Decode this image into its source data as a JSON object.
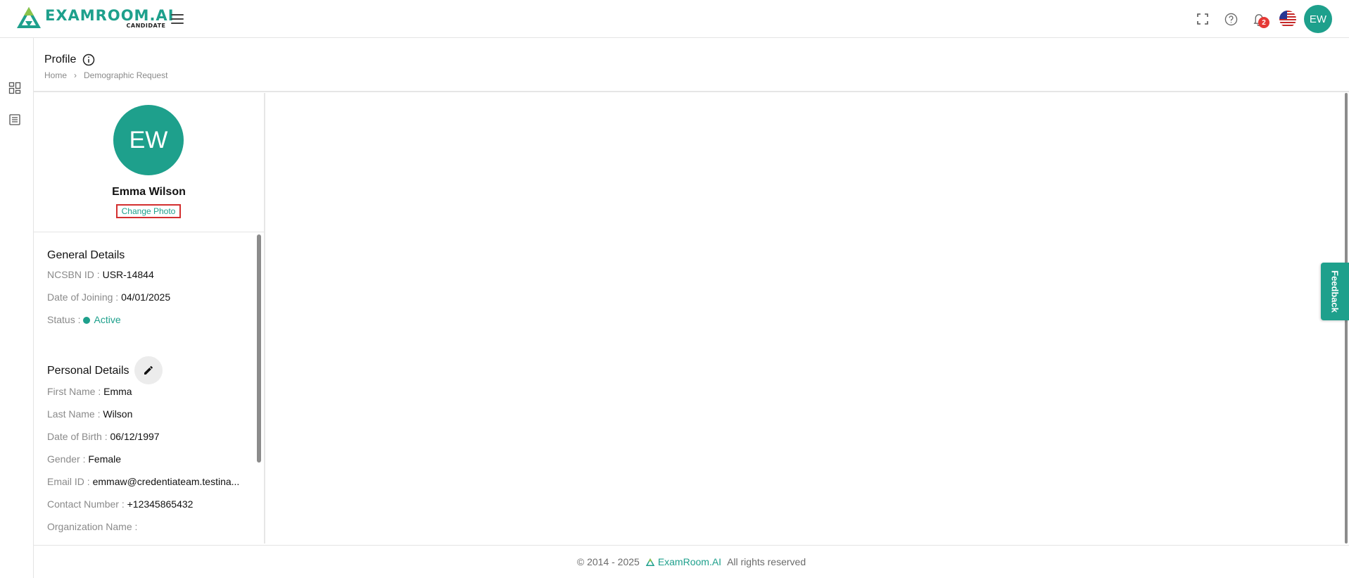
{
  "header": {
    "logo_word": "EXAMROOM.AI",
    "logo_sub": "CANDIDATE",
    "notification_count": "2",
    "user_initials": "EW"
  },
  "page": {
    "title": "Profile",
    "breadcrumb": [
      "Home",
      "Demographic Request"
    ]
  },
  "profile": {
    "initials": "EW",
    "name": "Emma Wilson",
    "change_photo": "Change Photo"
  },
  "general": {
    "title": "General Details",
    "rows": [
      {
        "label": "NCSBN ID :",
        "value": "USR-14844"
      },
      {
        "label": "Date of Joining :",
        "value": "04/01/2025"
      },
      {
        "label": "Status :",
        "value": "Active"
      }
    ]
  },
  "personal": {
    "title": "Personal Details",
    "rows": [
      {
        "label": "First Name :",
        "value": "Emma"
      },
      {
        "label": "Last Name :",
        "value": "Wilson"
      },
      {
        "label": "Date of Birth :",
        "value": "06/12/1997"
      },
      {
        "label": "Gender :",
        "value": "Female"
      },
      {
        "label": "Email ID :",
        "value": "emmaw@credentiateam.testina..."
      },
      {
        "label": "Contact Number :",
        "value": "+12345865432"
      },
      {
        "label": "Organization Name :",
        "value": ""
      }
    ]
  },
  "feedback": "Feedback",
  "footer": {
    "copyright": "© 2014 - 2025",
    "brand": "ExamRoom.AI",
    "rights": "All rights reserved"
  },
  "colors": {
    "accent": "#1ea08c",
    "badge": "#e53935",
    "highlight_border": "#d32f2f"
  }
}
